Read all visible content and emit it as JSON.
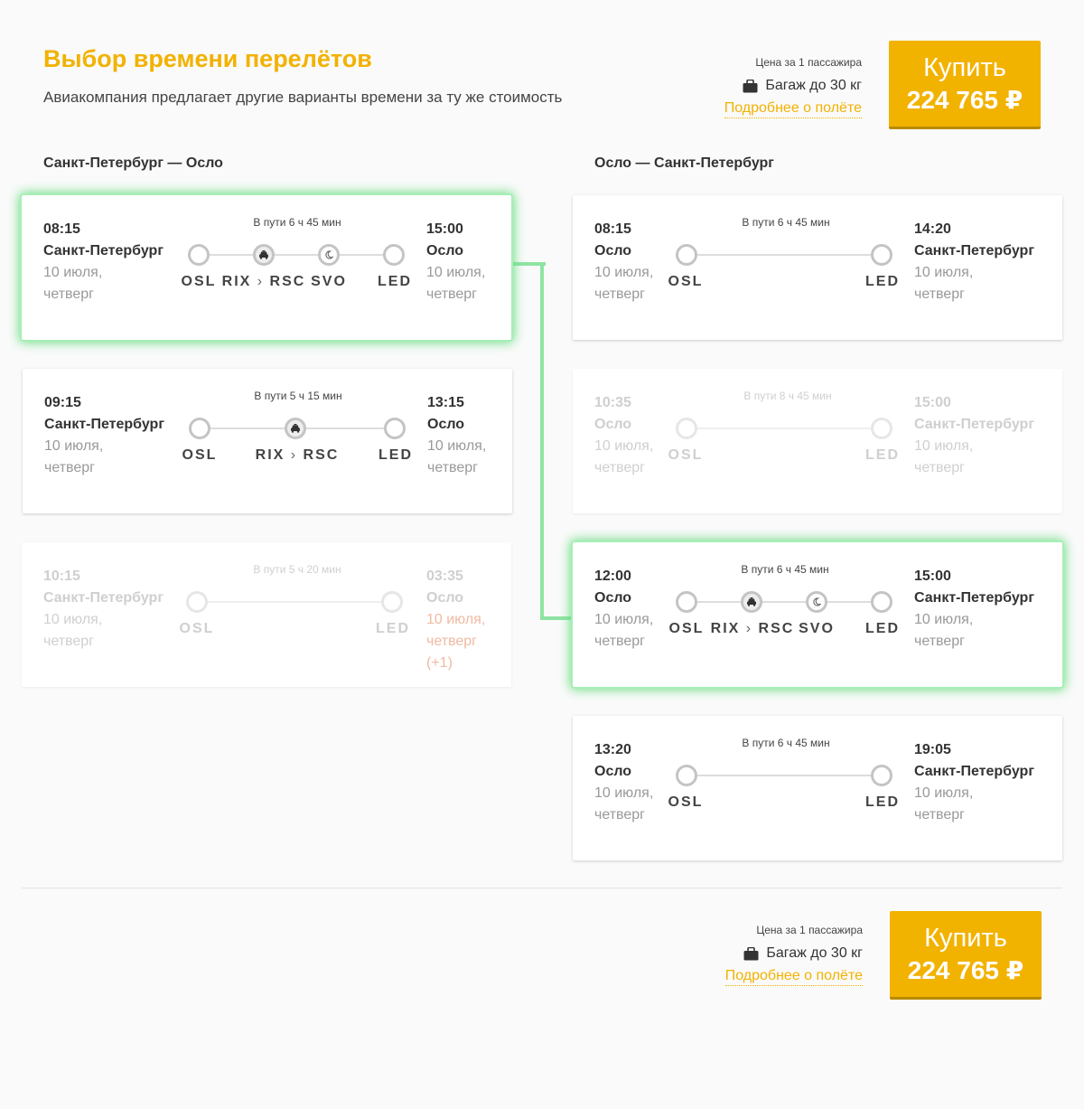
{
  "page": {
    "title": "Выбор времени перелётов",
    "subtitle": "Авиакомпания предлагает другие варианты времени за ту же стоимость"
  },
  "purchase": {
    "price_label": "Цена за 1 пассажира",
    "baggage": "Багаж до 30 кг",
    "details_link": "Подробнее о полёте",
    "buy_label": "Купить",
    "price": "224 765 ₽",
    "accent_color": "#f2b200"
  },
  "outbound": {
    "title": "Санкт-Петербург — Осло",
    "options": [
      {
        "dep_time": "08:15",
        "dep_city": "Санкт-Петербург",
        "dep_date": "10 июля,",
        "dep_day": "четверг",
        "duration": "В пути 6 ч 45 мин",
        "arr_time": "15:00",
        "arr_city": "Осло",
        "arr_date": "10 июля,",
        "arr_day": "четверг",
        "codes": [
          "OSL",
          "RIX",
          "RSC",
          "SVO",
          "LED"
        ],
        "stop_icons": [
          "taxi-icon",
          "moon-icon"
        ],
        "state": "selected"
      },
      {
        "dep_time": "09:15",
        "dep_city": "Санкт-Петербург",
        "dep_date": "10 июля,",
        "dep_day": "четверг",
        "duration": "В пути 5 ч 15 мин",
        "arr_time": "13:15",
        "arr_city": "Осло",
        "arr_date": "10 июля,",
        "arr_day": "четверг",
        "codes": [
          "OSL",
          "RIX",
          "RSC",
          "LED"
        ],
        "stop_icons": [
          "taxi-icon"
        ],
        "state": "available"
      },
      {
        "dep_time": "10:15",
        "dep_city": "Санкт-Петербург",
        "dep_date": "10 июля,",
        "dep_day": "четверг",
        "duration": "В пути 5 ч 20 мин",
        "arr_time": "03:35",
        "arr_city": "Осло",
        "arr_date": "10 июля,",
        "arr_day": "четверг",
        "arr_extra": "(+1)",
        "codes": [
          "OSL",
          "LED"
        ],
        "state": "disabled"
      }
    ]
  },
  "inbound": {
    "title": "Осло — Санкт-Петербург",
    "options": [
      {
        "dep_time": "08:15",
        "dep_city": "Осло",
        "dep_date": "10 июля,",
        "dep_day": "четверг",
        "duration": "В пути 6 ч 45 мин",
        "arr_time": "14:20",
        "arr_city": "Санкт-Петербург",
        "arr_date": "10 июля,",
        "arr_day": "четверг",
        "codes": [
          "OSL",
          "LED"
        ],
        "state": "available"
      },
      {
        "dep_time": "10:35",
        "dep_city": "Осло",
        "dep_date": "10 июля,",
        "dep_day": "четверг",
        "duration": "В пути 8 ч 45 мин",
        "arr_time": "15:00",
        "arr_city": "Санкт-Петербург",
        "arr_date": "10 июля,",
        "arr_day": "четверг",
        "codes": [
          "OSL",
          "LED"
        ],
        "state": "disabled"
      },
      {
        "dep_time": "12:00",
        "dep_city": "Осло",
        "dep_date": "10 июля,",
        "dep_day": "четверг",
        "duration": "В пути 6 ч 45 мин",
        "arr_time": "15:00",
        "arr_city": "Санкт-Петербург",
        "arr_date": "10 июля,",
        "arr_day": "четверг",
        "codes": [
          "OSL",
          "RIX",
          "RSC",
          "SVO",
          "LED"
        ],
        "stop_icons": [
          "taxi-icon",
          "moon-icon"
        ],
        "state": "selected"
      },
      {
        "dep_time": "13:20",
        "dep_city": "Осло",
        "dep_date": "10 июля,",
        "dep_day": "четверг",
        "duration": "В пути 6 ч 45 мин",
        "arr_time": "19:05",
        "arr_city": "Санкт-Петербург",
        "arr_date": "10 июля,",
        "arr_day": "четверг",
        "codes": [
          "OSL",
          "LED"
        ],
        "state": "available"
      }
    ]
  },
  "colors": {
    "selected_glow": "#6ddd85",
    "connector": "#8fe3a2",
    "next_day": "#f0b9a2"
  }
}
